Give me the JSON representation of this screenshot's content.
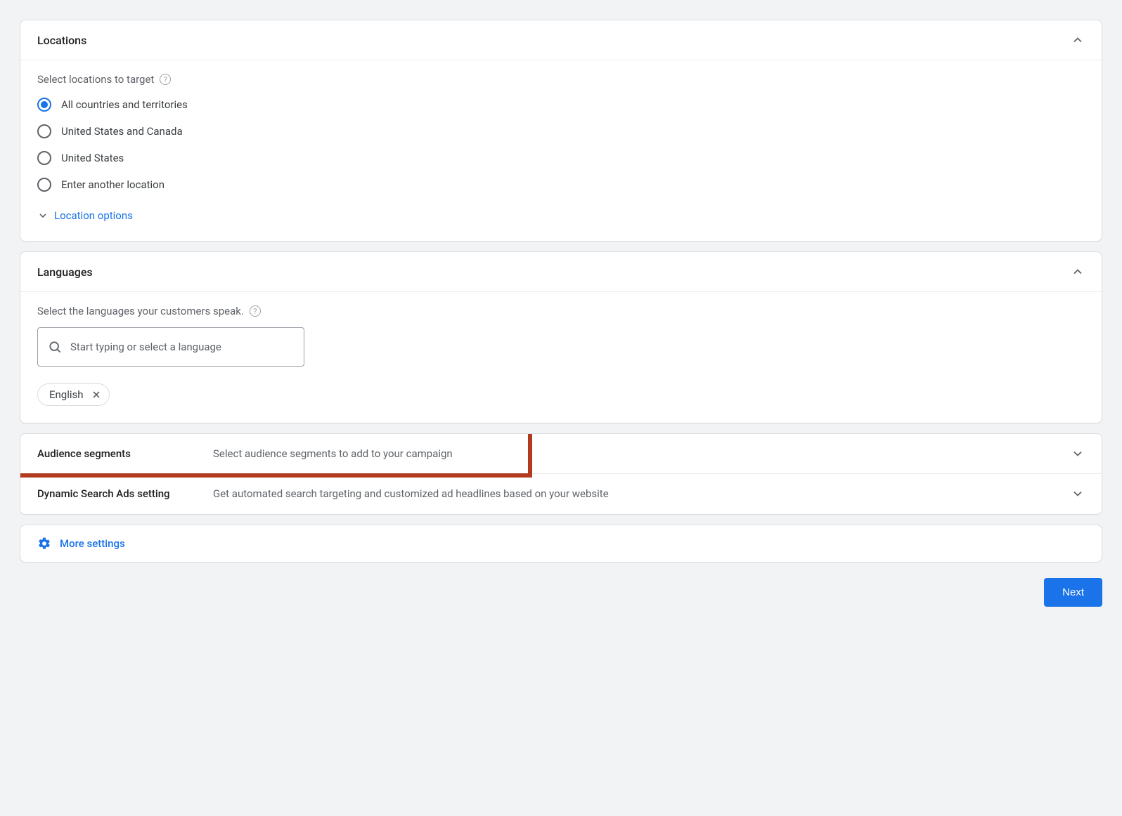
{
  "locations": {
    "title": "Locations",
    "subtitle": "Select locations to target",
    "options": [
      {
        "label": "All countries and territories",
        "checked": true
      },
      {
        "label": "United States and Canada",
        "checked": false
      },
      {
        "label": "United States",
        "checked": false
      },
      {
        "label": "Enter another location",
        "checked": false
      }
    ],
    "options_link": "Location options"
  },
  "languages": {
    "title": "Languages",
    "subtitle": "Select the languages your customers speak.",
    "search_placeholder": "Start typing or select a language",
    "chips": [
      "English"
    ]
  },
  "audience": {
    "title": "Audience segments",
    "desc": "Select audience segments to add to your campaign"
  },
  "dsa": {
    "title": "Dynamic Search Ads setting",
    "desc": "Get automated search targeting and customized ad headlines based on your website"
  },
  "more_settings": "More settings",
  "next_label": "Next"
}
